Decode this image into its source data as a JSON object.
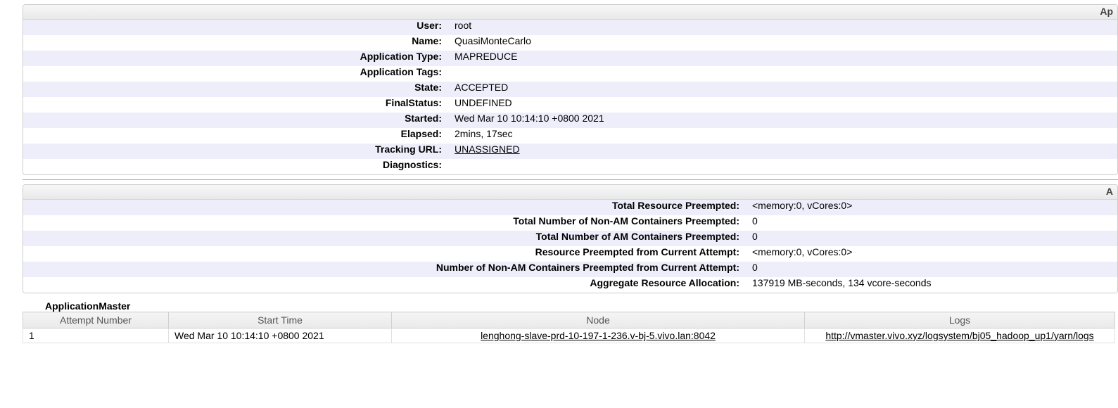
{
  "overview": {
    "header": "Ap",
    "rows": [
      {
        "label": "User:",
        "value": "root"
      },
      {
        "label": "Name:",
        "value": "QuasiMonteCarlo"
      },
      {
        "label": "Application Type:",
        "value": "MAPREDUCE"
      },
      {
        "label": "Application Tags:",
        "value": ""
      },
      {
        "label": "State:",
        "value": "ACCEPTED"
      },
      {
        "label": "FinalStatus:",
        "value": "UNDEFINED"
      },
      {
        "label": "Started:",
        "value": "Wed Mar 10 10:14:10 +0800 2021"
      },
      {
        "label": "Elapsed:",
        "value": "2mins, 17sec"
      },
      {
        "label": "Tracking URL:",
        "value": "UNASSIGNED",
        "link": true
      },
      {
        "label": "Diagnostics:",
        "value": ""
      }
    ]
  },
  "metrics": {
    "header": "A",
    "rows": [
      {
        "label": "Total Resource Preempted:",
        "value": "<memory:0, vCores:0>"
      },
      {
        "label": "Total Number of Non-AM Containers Preempted:",
        "value": "0"
      },
      {
        "label": "Total Number of AM Containers Preempted:",
        "value": "0"
      },
      {
        "label": "Resource Preempted from Current Attempt:",
        "value": "<memory:0, vCores:0>"
      },
      {
        "label": "Number of Non-AM Containers Preempted from Current Attempt:",
        "value": "0"
      },
      {
        "label": "Aggregate Resource Allocation:",
        "value": "137919 MB-seconds, 134 vcore-seconds"
      }
    ]
  },
  "am": {
    "title": "ApplicationMaster",
    "columns": [
      "Attempt Number",
      "Start Time",
      "Node",
      "Logs"
    ],
    "rows": [
      {
        "attempt": "1",
        "start": "Wed Mar 10 10:14:10 +0800 2021",
        "node": "lenghong-slave-prd-10-197-1-236.v-bj-5.vivo.lan:8042",
        "logs": "http://vmaster.vivo.xyz/logsystem/bj05_hadoop_up1/yarn/logs"
      }
    ]
  }
}
